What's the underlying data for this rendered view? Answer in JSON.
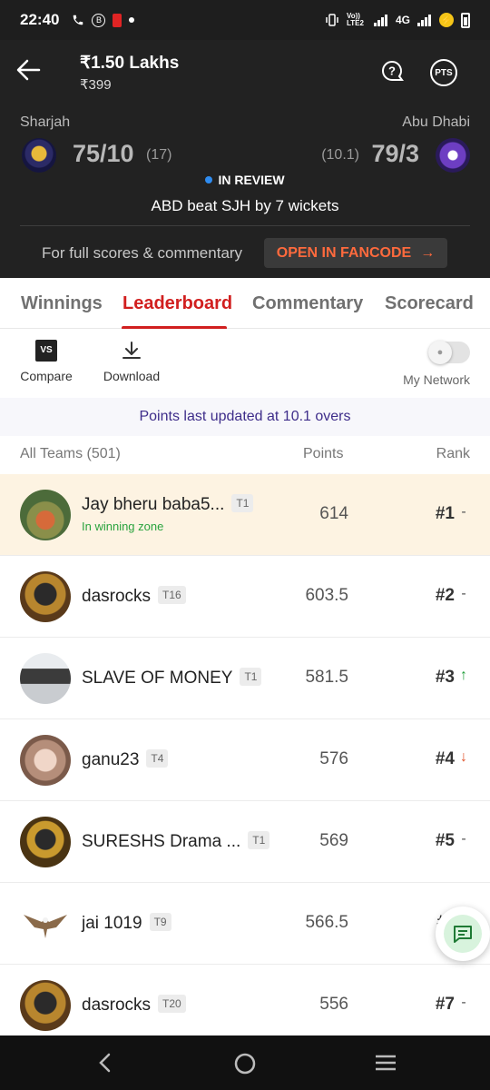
{
  "status_bar": {
    "time": "22:40",
    "network_label": "4G",
    "volte_label": "Vo)) LTE2",
    "badge_b": "B"
  },
  "header": {
    "prize": "₹1.50 Lakhs",
    "entry_fee": "₹399",
    "pts_label": "PTS",
    "team_left": {
      "name": "Sharjah",
      "score": "75/10",
      "overs": "(17)"
    },
    "team_right": {
      "name": "Abu Dhabi",
      "score": "79/3",
      "overs": "(10.1)"
    },
    "review_status": "IN REVIEW",
    "result": "ABD beat SJH by 7 wickets",
    "full_scores_text": "For full scores & commentary",
    "fancode_button": "OPEN IN FANCODE",
    "fancode_arrow": "→"
  },
  "tabs": [
    {
      "label": "Winnings",
      "active": false
    },
    {
      "label": "Leaderboard",
      "active": true
    },
    {
      "label": "Commentary",
      "active": false
    },
    {
      "label": "Scorecard",
      "active": false
    }
  ],
  "toolbar": {
    "compare_label": "Compare",
    "compare_icon_text": "VS",
    "download_label": "Download",
    "my_network_label": "My Network"
  },
  "updated_text": "Points last updated at 10.1 overs",
  "list_header": {
    "teams": "All Teams (501)",
    "points": "Points",
    "rank": "Rank"
  },
  "leaderboard": [
    {
      "name": "Jay bheru baba5...",
      "team": "T1",
      "points": "614",
      "rank": "#1",
      "trend": "-",
      "zone": "In winning zone"
    },
    {
      "name": "dasrocks",
      "team": "T16",
      "points": "603.5",
      "rank": "#2",
      "trend": "-"
    },
    {
      "name": "SLAVE OF MONEY",
      "team": "T1",
      "points": "581.5",
      "rank": "#3",
      "trend": "↑"
    },
    {
      "name": "ganu23",
      "team": "T4",
      "points": "576",
      "rank": "#4",
      "trend": "↓"
    },
    {
      "name": "SURESHS Drama ...",
      "team": "T1",
      "points": "569",
      "rank": "#5",
      "trend": "-"
    },
    {
      "name": "jai 1019",
      "team": "T9",
      "points": "566.5",
      "rank": "#",
      "trend": ""
    },
    {
      "name": "dasrocks",
      "team": "T20",
      "points": "556",
      "rank": "#7",
      "trend": "-"
    }
  ]
}
